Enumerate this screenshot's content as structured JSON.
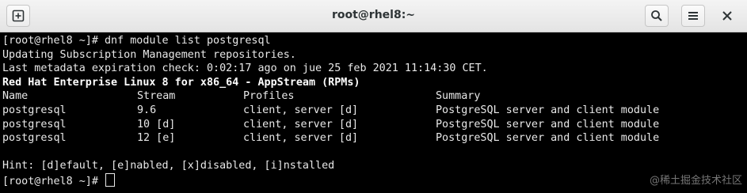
{
  "window": {
    "title": "root@rhel8:~"
  },
  "toolbar": {
    "new_tab_icon": "new-tab-icon",
    "search_icon": "search-icon",
    "menu_icon": "hamburger-menu-icon",
    "close_icon": "close-icon"
  },
  "terminal": {
    "cmd_line": "[root@rhel8 ~]# dnf module list postgresql",
    "line_updating": "Updating Subscription Management repositories.",
    "line_metadata": "Last metadata expiration check: 0:02:17 ago on jue 25 feb 2021 11:14:30 CET.",
    "repo_header": "Red Hat Enterprise Linux 8 for x86_64 - AppStream (RPMs)",
    "table": {
      "headers": [
        "Name",
        "Stream",
        "Profiles",
        "Summary"
      ],
      "rows": [
        [
          "postgresql",
          "9.6",
          "client, server [d]",
          "PostgreSQL server and client module"
        ],
        [
          "postgresql",
          "10 [d]",
          "client, server [d]",
          "PostgreSQL server and client module"
        ],
        [
          "postgresql",
          "12 [e]",
          "client, server [d]",
          "PostgreSQL server and client module"
        ]
      ]
    },
    "hint": "Hint: [d]efault, [e]nabled, [x]disabled, [i]nstalled",
    "prompt": "[root@rhel8 ~]# "
  },
  "watermark": "@稀土掘金技术社区"
}
